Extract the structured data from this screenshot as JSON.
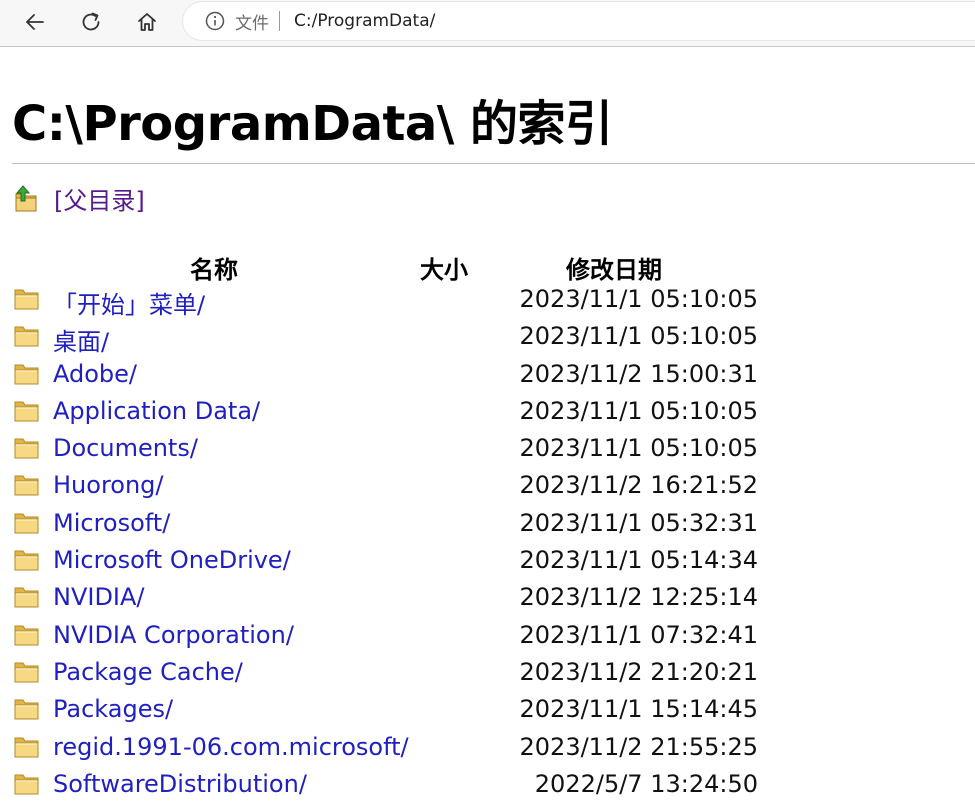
{
  "browser": {
    "scheme_label": "文件",
    "url": "C:/ProgramData/"
  },
  "page": {
    "title": "C:\\ProgramData\\ 的索引",
    "parent_dir_label": "[父目录]"
  },
  "table": {
    "headers": {
      "name": "名称",
      "size": "大小",
      "date": "修改日期"
    },
    "rows": [
      {
        "name": "「开始」菜单/",
        "size": "",
        "date": "2023/11/1 05:10:05"
      },
      {
        "name": "桌面/",
        "size": "",
        "date": "2023/11/1 05:10:05"
      },
      {
        "name": "Adobe/",
        "size": "",
        "date": "2023/11/2 15:00:31"
      },
      {
        "name": "Application Data/",
        "size": "",
        "date": "2023/11/1 05:10:05"
      },
      {
        "name": "Documents/",
        "size": "",
        "date": "2023/11/1 05:10:05"
      },
      {
        "name": "Huorong/",
        "size": "",
        "date": "2023/11/2 16:21:52"
      },
      {
        "name": "Microsoft/",
        "size": "",
        "date": "2023/11/1 05:32:31"
      },
      {
        "name": "Microsoft OneDrive/",
        "size": "",
        "date": "2023/11/1 05:14:34"
      },
      {
        "name": "NVIDIA/",
        "size": "",
        "date": "2023/11/2 12:25:14"
      },
      {
        "name": "NVIDIA Corporation/",
        "size": "",
        "date": "2023/11/1 07:32:41"
      },
      {
        "name": "Package Cache/",
        "size": "",
        "date": "2023/11/2 21:20:21"
      },
      {
        "name": "Packages/",
        "size": "",
        "date": "2023/11/1 15:14:45"
      },
      {
        "name": "regid.1991-06.com.microsoft/",
        "size": "",
        "date": "2023/11/2 21:55:25"
      },
      {
        "name": "SoftwareDistribution/",
        "size": "",
        "date": "2022/5/7 13:24:50"
      }
    ]
  },
  "icons": {
    "back": "back-arrow-icon",
    "reload": "reload-icon",
    "home": "home-icon",
    "info": "info-icon",
    "parent": "parent-folder-up-icon",
    "folder": "folder-icon"
  },
  "colors": {
    "link": "#2020c0",
    "visited_link": "#551a8b",
    "folder": "#f0c75e"
  }
}
